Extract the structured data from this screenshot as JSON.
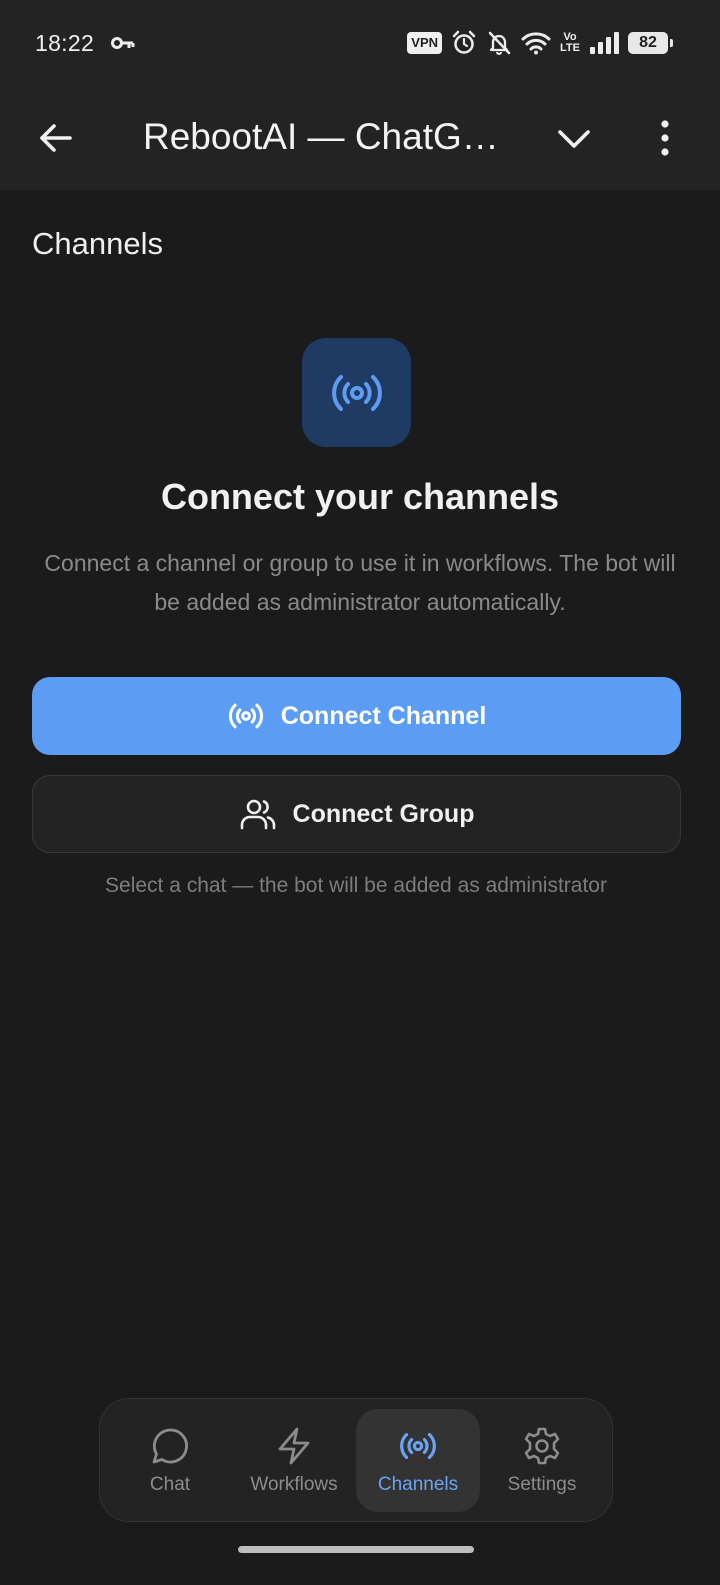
{
  "status_bar": {
    "time": "18:22",
    "vpn_label": "VPN",
    "volte_top": "Vo",
    "volte_bottom": "LTE",
    "battery": "82",
    "icons": [
      "key-icon",
      "vpn-badge",
      "alarm-icon",
      "bell-off-icon",
      "wifi-icon",
      "volte-icon",
      "signal-icon",
      "battery-icon"
    ]
  },
  "app_bar": {
    "title": "RebootAI — ChatGPT",
    "icons": [
      "arrow-left-icon",
      "chevron-down-icon",
      "more-vertical-icon"
    ]
  },
  "main": {
    "section_title": "Channels",
    "hero_icon": "broadcast-icon",
    "heading": "Connect your channels",
    "description": "Connect a channel or group to use it in workflows. The bot will be added as administrator automatically.",
    "primary_button": {
      "label": "Connect Channel",
      "icon": "broadcast-icon"
    },
    "secondary_button": {
      "label": "Connect Group",
      "icon": "users-icon"
    },
    "hint": "Select a chat — the bot will be added as administrator"
  },
  "bottom_nav": {
    "items": [
      {
        "label": "Chat",
        "icon": "message-circle-icon",
        "active": false
      },
      {
        "label": "Workflows",
        "icon": "zap-icon",
        "active": false
      },
      {
        "label": "Channels",
        "icon": "broadcast-icon",
        "active": true
      },
      {
        "label": "Settings",
        "icon": "gear-icon",
        "active": false
      }
    ]
  },
  "colors": {
    "background": "#1b1b1b",
    "bar": "#232323",
    "accent": "#5b9cf4",
    "accent_icon": "#6aa3f2",
    "hero_tile": "#1f3a63",
    "muted_text": "#8a8a8a"
  }
}
